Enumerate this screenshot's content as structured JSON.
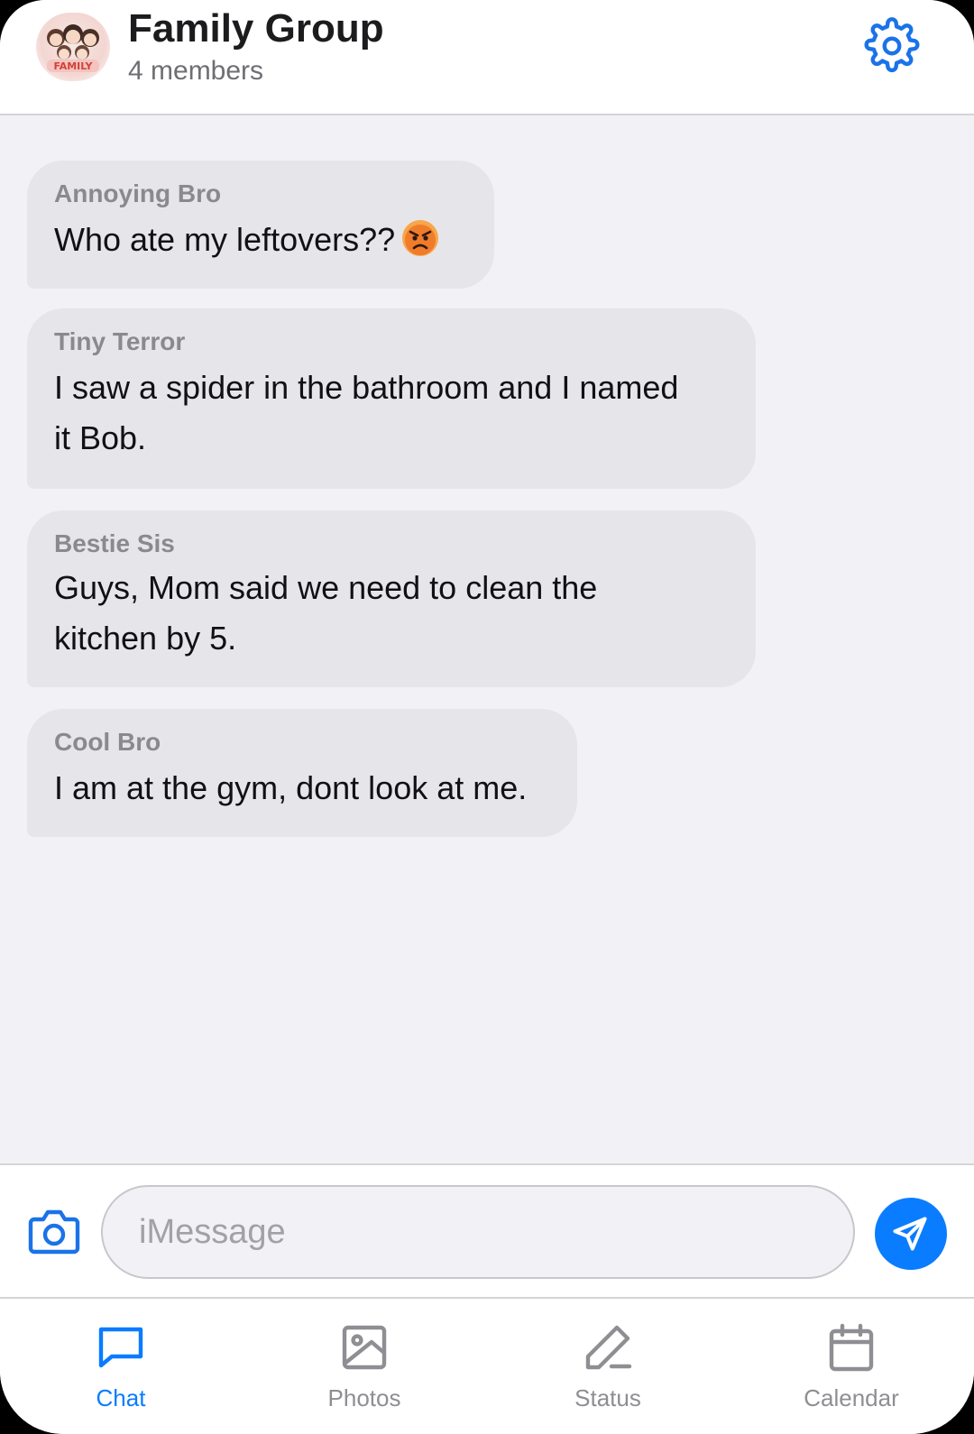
{
  "header": {
    "title": "Family Group",
    "subtitle": "4 members",
    "avatar_text": "FAMILY"
  },
  "messages": [
    {
      "sender": "Annoying Bro",
      "text": "Who ate my leftovers??",
      "emoji": "angry-face-icon"
    },
    {
      "sender": "Tiny Terror",
      "text_line1": "I saw a spider in the bathroom and I named",
      "text_line2": "it Bob."
    },
    {
      "sender": "Bestie Sis",
      "text_line1": "Guys, Mom said we need to clean the",
      "text_line2": "kitchen by 5."
    },
    {
      "sender": "Cool Bro",
      "text": "I am at the gym, dont look at me."
    }
  ],
  "composer": {
    "placeholder": "iMessage",
    "value": ""
  },
  "tabs": [
    {
      "label": "Chat",
      "icon": "chat-bubble-icon",
      "active": true
    },
    {
      "label": "Photos",
      "icon": "image-icon",
      "active": false
    },
    {
      "label": "Status",
      "icon": "pencil-icon",
      "active": false
    },
    {
      "label": "Calendar",
      "icon": "calendar-icon",
      "active": false
    }
  ],
  "colors": {
    "accent": "#0a7cff",
    "bubble": "#e6e6ea",
    "background": "#f2f2f6",
    "inactive": "#8e8e93"
  }
}
